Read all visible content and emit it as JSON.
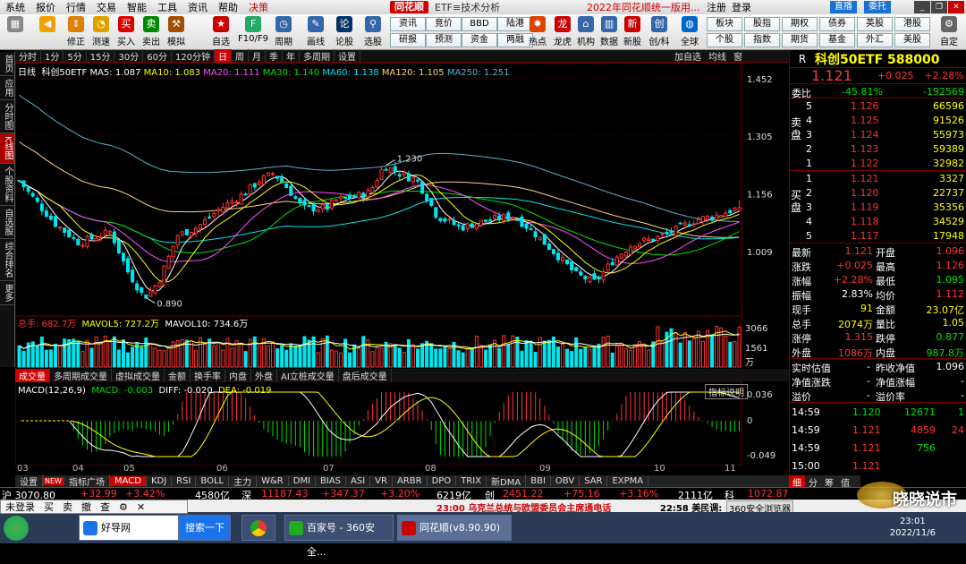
{
  "app": {
    "menu": [
      "系统",
      "报价",
      "行情",
      "交易",
      "智能",
      "工具",
      "资讯",
      "帮助",
      "决策"
    ],
    "brand": "同花顺",
    "title": "ETF≡技术分析",
    "ad": "2022年同花顺统一版用...",
    "login": "注册",
    "register": "登录",
    "live": "直播",
    "entrust": "委托"
  },
  "toolbar": {
    "main": [
      "修正",
      "测速",
      "买入",
      "卖出",
      "模拟",
      "自选",
      "F10/F9",
      "周期",
      "画线",
      "论股",
      "选股"
    ],
    "grid": [
      [
        "资讯",
        "竞价",
        "BBD",
        "陆港"
      ],
      [
        "研报",
        "预测",
        "资金",
        "两融"
      ]
    ],
    "icons2": [
      "热点",
      "龙虎",
      "机构",
      "数据",
      "新股",
      "创/科",
      "全球"
    ],
    "grid2": [
      [
        "板块",
        "股指",
        "期权",
        "债券",
        "英股",
        "港股"
      ],
      [
        "个股",
        "指数",
        "期货",
        "基金",
        "外汇",
        "美股"
      ]
    ],
    "custom": "自定"
  },
  "lefttabs": [
    "首页",
    "应用",
    "分时图",
    "K线图",
    "个股资料",
    "自选股",
    "综合排名",
    "更多"
  ],
  "periods": [
    "分时",
    "1分",
    "5分",
    "15分",
    "30分",
    "60分",
    "120分钟",
    "日",
    "周",
    "月",
    "季",
    "年",
    "多周期",
    "设置"
  ],
  "period_right": [
    "加自选",
    "均线",
    "窗"
  ],
  "legend": {
    "k": "日线",
    "name": "科创50ETF",
    "ma5": "MA5: 1.087",
    "ma10": "MA10: 1.083",
    "ma20": "MA20: 1.111",
    "ma30": "MA30: 1.140",
    "ma60": "MA60: 1.138",
    "ma120": "MA120: 1.105",
    "ma250": "MA250: 1.251"
  },
  "price_axis": [
    "1.452",
    "1.305",
    "1.156",
    "1.009"
  ],
  "annotations": {
    "high": "1.230",
    "low": "0.890"
  },
  "vol": {
    "total": "总手: 682.7万",
    "mavol5": "MAVOL5: 727.2万",
    "mavol10": "MAVOL10: 734.6万",
    "axis": [
      "3066",
      "1561",
      "万"
    ]
  },
  "ind_tabs": [
    "成交量",
    "多周期成交量",
    "虚拟成交量",
    "金额",
    "换手率",
    "内盘",
    "外盘",
    "AI立桩成交量",
    "盘后成交量"
  ],
  "macd": {
    "name": "MACD(12,26,9)",
    "macd": "MACD: -0.003",
    "diff": "DIFF: -0.020",
    "dea": "DEA: -0.019",
    "help": "指标说明",
    "axis": [
      "0.036",
      "0",
      "-0.049"
    ]
  },
  "xaxis": [
    "03",
    "04",
    "05",
    "06",
    "07",
    "08",
    "09",
    "10",
    "11"
  ],
  "bottom_tabs": [
    "设置",
    "NEW",
    "指标广场",
    "MACD",
    "KDJ",
    "RSI",
    "BOLL",
    "主力",
    "W&R",
    "DMI",
    "BIAS",
    "ASI",
    "VR",
    "ARBR",
    "DPO",
    "TRIX",
    "新DMA",
    "BBI",
    "OBV",
    "SAR",
    "EXPMA"
  ],
  "ticker": {
    "a": "沪 3070.80",
    "a2": "+32.99",
    "a3": "+3.42%",
    "a4": "4580亿",
    "b": "深",
    "b1": "11187.43",
    "b2": "+347.37",
    "b3": "+3.20%",
    "b4": "6219亿",
    "c": "创",
    "c1": "2451.22",
    "c2": "+75.16",
    "c3": "+3.16%",
    "c4": "2111亿",
    "d": "科",
    "d1": "1072.87"
  },
  "status": {
    "ann": "23:00 乌克兰总统与欧盟委员会主席通电话",
    "t2": "22:58 美民调:",
    "browser": "360安全浏览器"
  },
  "popup": [
    "未登录",
    "买",
    "卖",
    "撤",
    "查"
  ],
  "taskbar": {
    "t1": "好导网",
    "search": "搜索一下",
    "t2": "百家号 - 360安全...",
    "t3": "同花顺(v8.90.90)",
    "time": "23:01",
    "date": "2022/11/6"
  },
  "watermark": "晓晓说市",
  "quote": {
    "r": "R",
    "name": "科创50ETF 588000",
    "price": "1.121",
    "chg": "+0.025",
    "pct": "+2.28%",
    "weibi": "委比",
    "weibi_pct": "-45.81%",
    "weibi_diff": "-192569",
    "sell": [
      [
        "5",
        "1.126",
        "66596"
      ],
      [
        "4",
        "1.125",
        "91526"
      ],
      [
        "3",
        "1.124",
        "55973"
      ],
      [
        "2",
        "1.123",
        "59389"
      ],
      [
        "1",
        "1.122",
        "32982"
      ]
    ],
    "buy": [
      [
        "1",
        "1.121",
        "3327"
      ],
      [
        "2",
        "1.120",
        "22737"
      ],
      [
        "3",
        "1.119",
        "35356"
      ],
      [
        "4",
        "1.118",
        "34529"
      ],
      [
        "5",
        "1.117",
        "17948"
      ]
    ],
    "sell_label": "卖盘",
    "buy_label": "买盘",
    "stats": [
      [
        "最新",
        "1.121",
        "开盘",
        "1.096"
      ],
      [
        "涨跌",
        "+0.025",
        "最高",
        "1.126"
      ],
      [
        "涨幅",
        "+2.28%",
        "最低",
        "1.095"
      ],
      [
        "振幅",
        "2.83%",
        "均价",
        "1.112"
      ],
      [
        "现手",
        "91",
        "金额",
        "23.07亿"
      ],
      [
        "总手",
        "2074万",
        "量比",
        "1.05"
      ],
      [
        "涨停",
        "1.315",
        "跌停",
        "0.877"
      ],
      [
        "外盘",
        "1086万",
        "内盘",
        "987.8万"
      ]
    ],
    "nav": [
      [
        "实时估值",
        "-",
        "昨收净值",
        "1.096"
      ],
      [
        "净值涨跌",
        "-",
        "净值涨幅",
        "-"
      ],
      [
        "溢价",
        "-",
        "溢价率",
        "-"
      ]
    ],
    "ticks": [
      [
        "14:59",
        "1.120",
        "12671",
        "1"
      ],
      [
        "14:59",
        "1.121",
        "4859",
        "24"
      ],
      [
        "14:59",
        "1.121",
        "756",
        ""
      ],
      [
        "15:00",
        "1.121",
        "",
        ""
      ]
    ],
    "tabs": [
      "细",
      "分",
      "筹",
      "值"
    ]
  },
  "chart_data": {
    "type": "candlestick",
    "x_months": [
      "03",
      "04",
      "05",
      "06",
      "07",
      "08",
      "09",
      "10",
      "11"
    ],
    "price_range": [
      0.85,
      1.47
    ],
    "high": 1.23,
    "low": 0.89,
    "last": 1.121
  }
}
